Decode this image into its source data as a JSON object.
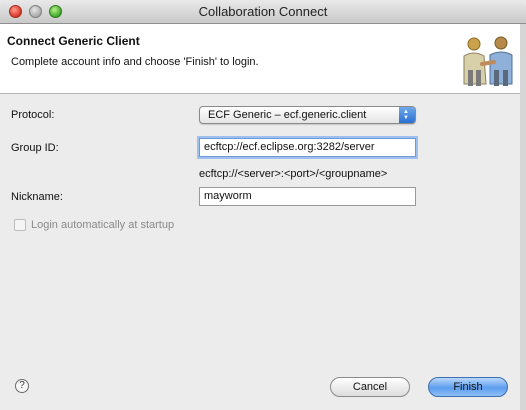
{
  "window": {
    "title": "Collaboration Connect"
  },
  "banner": {
    "title": "Connect Generic Client",
    "description": "Complete account info and choose 'Finish' to login.",
    "graphic_icon": "handshake-icon"
  },
  "form": {
    "protocol_label": "Protocol:",
    "protocol_value": "ECF Generic – ecf.generic.client",
    "group_id_label": "Group ID:",
    "group_id_value": "ecftcp://ecf.eclipse.org:3282/server",
    "group_id_hint": "ecftcp://<server>:<port>/<groupname>",
    "nickname_label": "Nickname:",
    "nickname_value": "mayworm",
    "login_auto_label": "Login automatically at startup",
    "login_auto_checked": false
  },
  "footer": {
    "help_symbol": "?",
    "cancel_label": "Cancel",
    "finish_label": "Finish"
  },
  "colors": {
    "finish_button": "#5d9ded",
    "focus_ring": "#9ec0ef"
  }
}
